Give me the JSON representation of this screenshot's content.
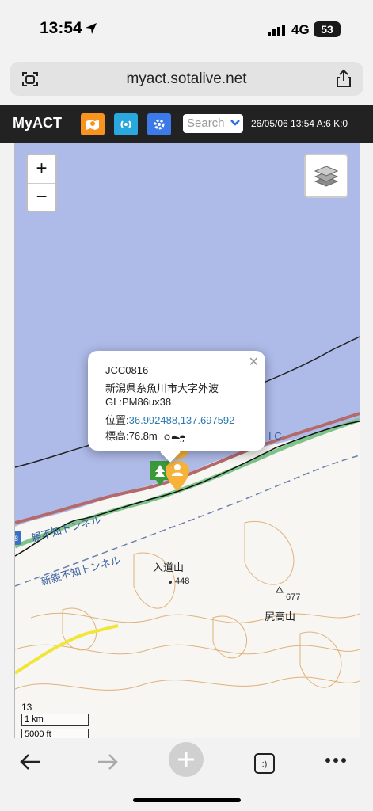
{
  "status": {
    "time": "13:54",
    "network": "4G",
    "battery": "53"
  },
  "browser": {
    "url": "myact.sotalive.net"
  },
  "app": {
    "brand": "MyACT",
    "search_placeholder": "Search",
    "info": "26/05/06 13:54 A:6 K:0"
  },
  "map": {
    "zoom_in": "+",
    "zoom_out": "−",
    "popup": {
      "ref": "JCC0816",
      "address": "新潟県糸魚川市大字外波",
      "gl": "GL:PM86ux38",
      "position_label": "位置:",
      "position_value": "36.992488,137.697592",
      "elevation": "標高:76.8m"
    },
    "labels": {
      "tunnel1": "親不知トンネル",
      "tunnel2": "新親不知トンネル",
      "mtn1": "入道山",
      "mtn1_elev": "448",
      "mtn2": "尻高山",
      "mtn2_elev": "677",
      "ic": "I C",
      "route": "8"
    },
    "zoom_level": "13",
    "scale_km": "1 km",
    "scale_ft": "5000 ft"
  },
  "colors": {
    "sea": "#aebbe8",
    "appbar": "#222222",
    "orange": "#f7931e",
    "cyan": "#29a8e0",
    "blue": "#3b7ae8"
  }
}
